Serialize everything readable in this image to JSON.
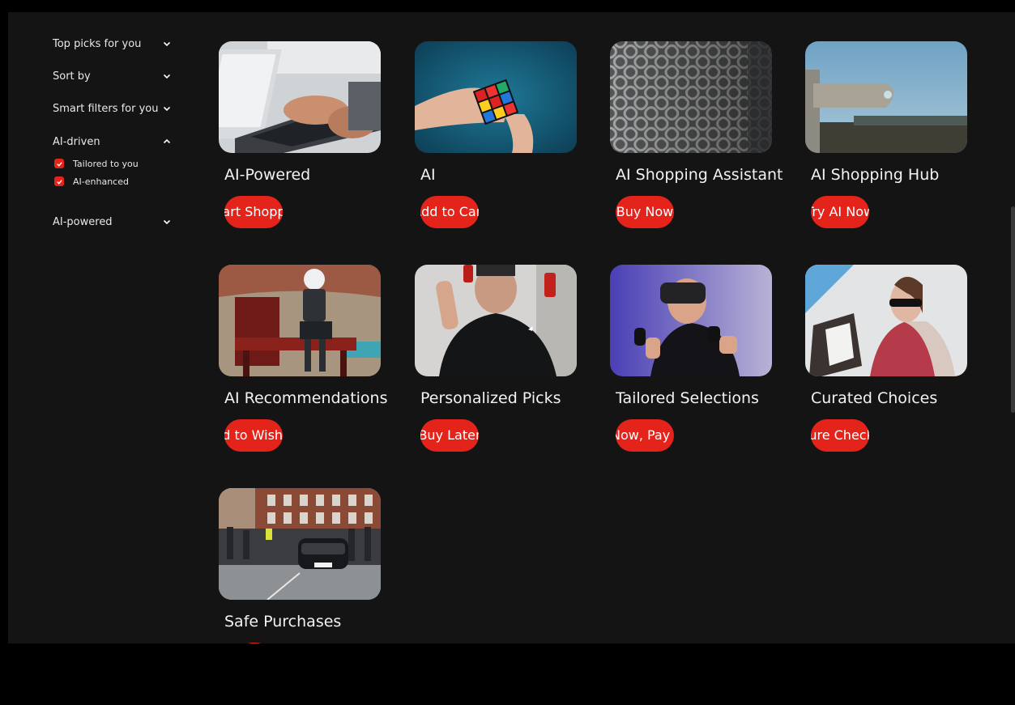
{
  "sidebar": {
    "filters": [
      {
        "label": "Top picks for you",
        "expanded": false
      },
      {
        "label": "Sort by",
        "expanded": false
      },
      {
        "label": "Smart filters for you",
        "expanded": false
      },
      {
        "label": "AI-driven",
        "expanded": true
      },
      {
        "label": "AI-powered",
        "expanded": false
      }
    ],
    "options": [
      {
        "label": "Tailored to you",
        "checked": true
      },
      {
        "label": "AI-enhanced",
        "checked": true
      }
    ]
  },
  "products": [
    {
      "title": "AI-Powered",
      "button": "Smart Shopping",
      "image": "laptop-typing-photo"
    },
    {
      "title": "AI",
      "button": "Add to Cart",
      "image": "rubiks-cube-photo"
    },
    {
      "title": "AI Shopping Assistant",
      "button": "Buy Now",
      "image": "chain-fence-photo"
    },
    {
      "title": "AI Shopping Hub",
      "button": "Try AI Now",
      "image": "signpost-photo"
    },
    {
      "title": "AI Recommendations",
      "button": "Add to Wishlist",
      "image": "robot-bench-photo"
    },
    {
      "title": "Personalized Picks",
      "button": "Buy Later",
      "image": "man-juggling-photo"
    },
    {
      "title": "Tailored Selections",
      "button": "Buy Now, Pay Later",
      "image": "vr-headset-photo"
    },
    {
      "title": "Curated Choices",
      "button": "Secure Checkout",
      "image": "woman-shopping-photo"
    },
    {
      "title": "Safe Purchases",
      "button": "",
      "image": "street-crowd-car-photo"
    }
  ],
  "colors": {
    "accent": "#e4231b",
    "background": "#141414"
  }
}
